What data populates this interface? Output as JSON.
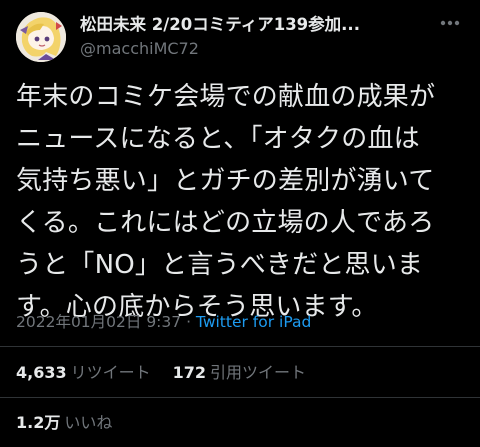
{
  "author": {
    "display_name": "松田未来 2/20コミティア139参加...",
    "handle": "@macchiMC72"
  },
  "tweet": {
    "lines": [
      "年末のコミケ会場での献血の成果が",
      "ニュースになると、「オタクの血は",
      "気持ち悪い」とガチの差別が湧いて",
      "くる。これにはどの立場の人であろ",
      "うと「NO」と言うべきだと思いま",
      "す。心の底からそう思います。"
    ],
    "timestamp": "2022年01月02日 9:37",
    "separator": " · ",
    "source": "Twitter for iPad"
  },
  "stats": {
    "retweets_count": "4,633",
    "retweets_label": "リツイート",
    "quotes_count": "172",
    "quotes_label": "引用ツイート",
    "likes_count": "1.2万",
    "likes_label": "いいね"
  },
  "icons": {
    "more": "more-dots-icon",
    "avatar": "avatar-illustration"
  },
  "colors": {
    "background": "#000000",
    "text": "#e7e9ea",
    "secondary": "#71767b",
    "link": "#1d9bf0",
    "divider": "#2f3336"
  }
}
